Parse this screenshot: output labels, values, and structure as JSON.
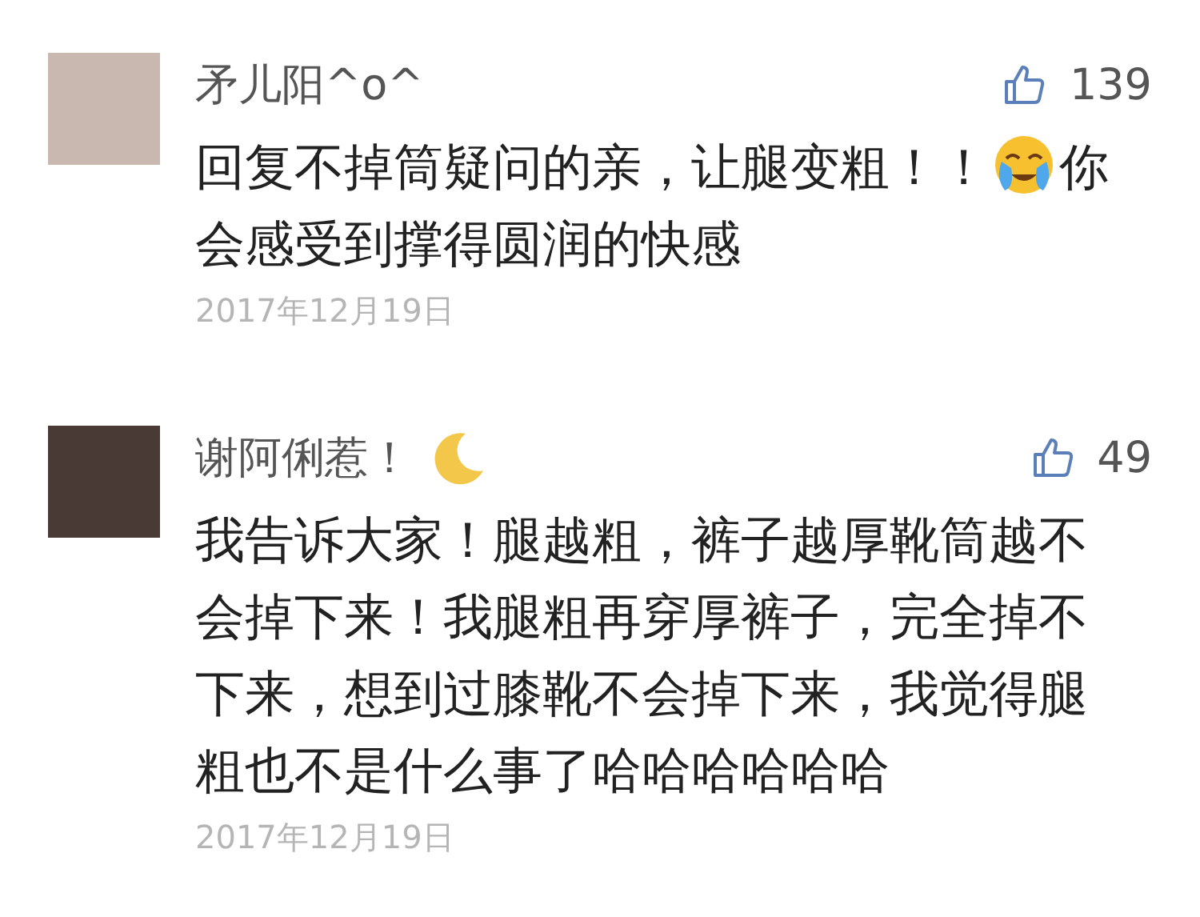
{
  "comments": [
    {
      "author": "矛儿阳^o^",
      "moon_emoji": false,
      "likes": "139",
      "parts": [
        {
          "kind": "text",
          "text": "回复不掉筒疑问的亲，让腿变粗！！"
        },
        {
          "kind": "emoji"
        },
        {
          "kind": "text",
          "text": "你"
        },
        {
          "kind": "text",
          "text": "会感受到撑得圆润的快感"
        }
      ],
      "date": "2017年12月19日"
    },
    {
      "author": "谢阿俐惹！",
      "moon_emoji": true,
      "likes": "49",
      "parts": [
        {
          "kind": "text",
          "text": "我告诉大家！腿越粗，裤子越厚靴筒越不会掉下来！我腿粗再穿厚裤子，完全掉不下来，想到过膝靴不会掉下来，我觉得腿粗也不是什么事了哈哈哈哈哈哈"
        }
      ],
      "date": "2017年12月19日"
    }
  ]
}
